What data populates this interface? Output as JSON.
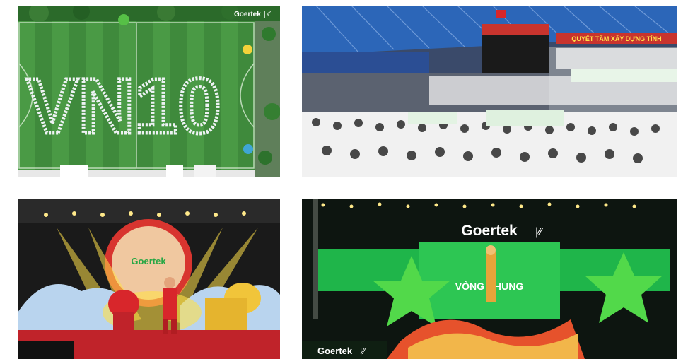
{
  "gallery": {
    "photos": [
      {
        "brand_watermark": "Goertek",
        "formation_text": "VN10",
        "colors": {
          "field": "#3f8a3c",
          "field_stripe": "#4a9a45",
          "trees": "#2b6a2a"
        }
      },
      {
        "banner_text": "QUYẾT TÂM XÂY DỰNG TỈNH",
        "colors": {
          "roof": "#2c66b8",
          "crowd": "#f1f1f1",
          "banner": "#c8342e"
        }
      },
      {
        "event_sign": "Goertek",
        "colors": {
          "stage": "#1a1a1a",
          "light": "#ffe04a",
          "lion_red": "#d8262b",
          "lion_yellow": "#f1c53a"
        }
      },
      {
        "brand_logo": "Goertek",
        "stage_title": "VÒNG CHUNG",
        "corner_watermark": "Goertek",
        "colors": {
          "screen": "#1fb54a",
          "star": "#52d94a",
          "dragon": "#e6522c"
        }
      }
    ]
  }
}
